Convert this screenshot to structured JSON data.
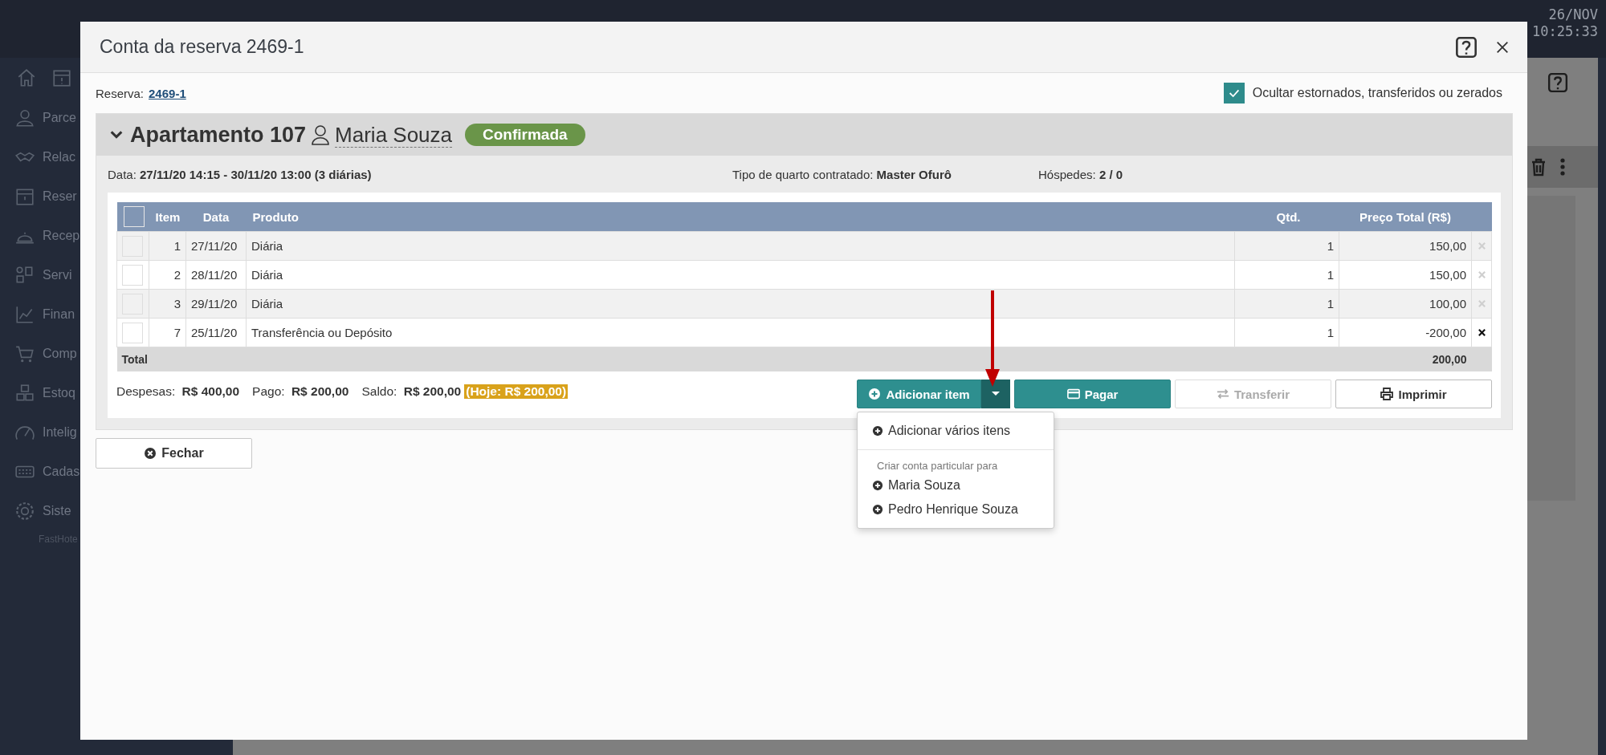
{
  "app": {
    "clock": {
      "date": "26/NOV",
      "time": "10:25:33"
    },
    "sidebar": {
      "items": [
        {
          "label": "Parce"
        },
        {
          "label": "Relac"
        },
        {
          "label": "Reser"
        },
        {
          "label": "Recep"
        },
        {
          "label": "Servi"
        },
        {
          "label": "Finan"
        },
        {
          "label": "Comp"
        },
        {
          "label": "Estoq"
        },
        {
          "label": "Intelig"
        },
        {
          "label": "Cadas"
        },
        {
          "label": "Siste"
        }
      ],
      "footer": "FastHote"
    }
  },
  "modal": {
    "title": "Conta da reserva 2469-1",
    "reservation": {
      "label": "Reserva:",
      "link": "2469-1"
    },
    "hide_option": {
      "label": "Ocultar estornados, transferidos ou zerados",
      "checked": true
    },
    "room": {
      "expanded": true,
      "title": "Apartamento 107",
      "guest": "Maria Souza",
      "status": "Confirmada",
      "info": [
        {
          "label": "Data:",
          "value": "27/11/20 14:15 - 30/11/20 13:00 (3 diárias)"
        },
        {
          "label": "Tipo de quarto contratado:",
          "value": "Master Ofurô"
        },
        {
          "label": "Hóspedes:",
          "value": "2 / 0"
        }
      ]
    },
    "table": {
      "columns": [
        "Item",
        "Data",
        "Produto",
        "Qtd.",
        "Preço Total (R$)"
      ],
      "all_checked": false,
      "rows": [
        {
          "item": "1",
          "date": "27/11/20",
          "product": "Diária",
          "qty": "1",
          "total": "150,00",
          "removable": false,
          "checked": false
        },
        {
          "item": "2",
          "date": "28/11/20",
          "product": "Diária",
          "qty": "1",
          "total": "150,00",
          "removable": false,
          "checked": false
        },
        {
          "item": "3",
          "date": "29/11/20",
          "product": "Diária",
          "qty": "1",
          "total": "100,00",
          "removable": false,
          "checked": false
        },
        {
          "item": "7",
          "date": "25/11/20",
          "product": "Transferência ou Depósito",
          "qty": "1",
          "total": "-200,00",
          "removable": true,
          "checked": false
        }
      ],
      "total_label": "Total",
      "total_value": "200,00"
    },
    "summary": [
      {
        "label": "Despesas:",
        "value": "R$ 400,00"
      },
      {
        "label": "Pago:",
        "value": "R$ 200,00"
      },
      {
        "label": "Saldo:",
        "value": "R$ 200,00"
      }
    ],
    "today": "(Hoje: R$ 200,00)",
    "buttons": [
      {
        "kind": "add",
        "label": "Adicionar item",
        "disabled": false
      },
      {
        "kind": "pay",
        "label": "Pagar",
        "disabled": false
      },
      {
        "kind": "transfer",
        "label": "Transferir",
        "disabled": true
      },
      {
        "kind": "print",
        "label": "Imprimir",
        "disabled": false
      }
    ],
    "dropdown": {
      "open": true,
      "items": [
        {
          "kind": "action",
          "label": "Adicionar vários itens"
        },
        {
          "kind": "header",
          "label": "Criar conta particular para"
        },
        {
          "kind": "action",
          "label": "Maria Souza"
        },
        {
          "kind": "action",
          "label": "Pedro Henrique Souza"
        }
      ]
    },
    "close_button": "Fechar"
  }
}
